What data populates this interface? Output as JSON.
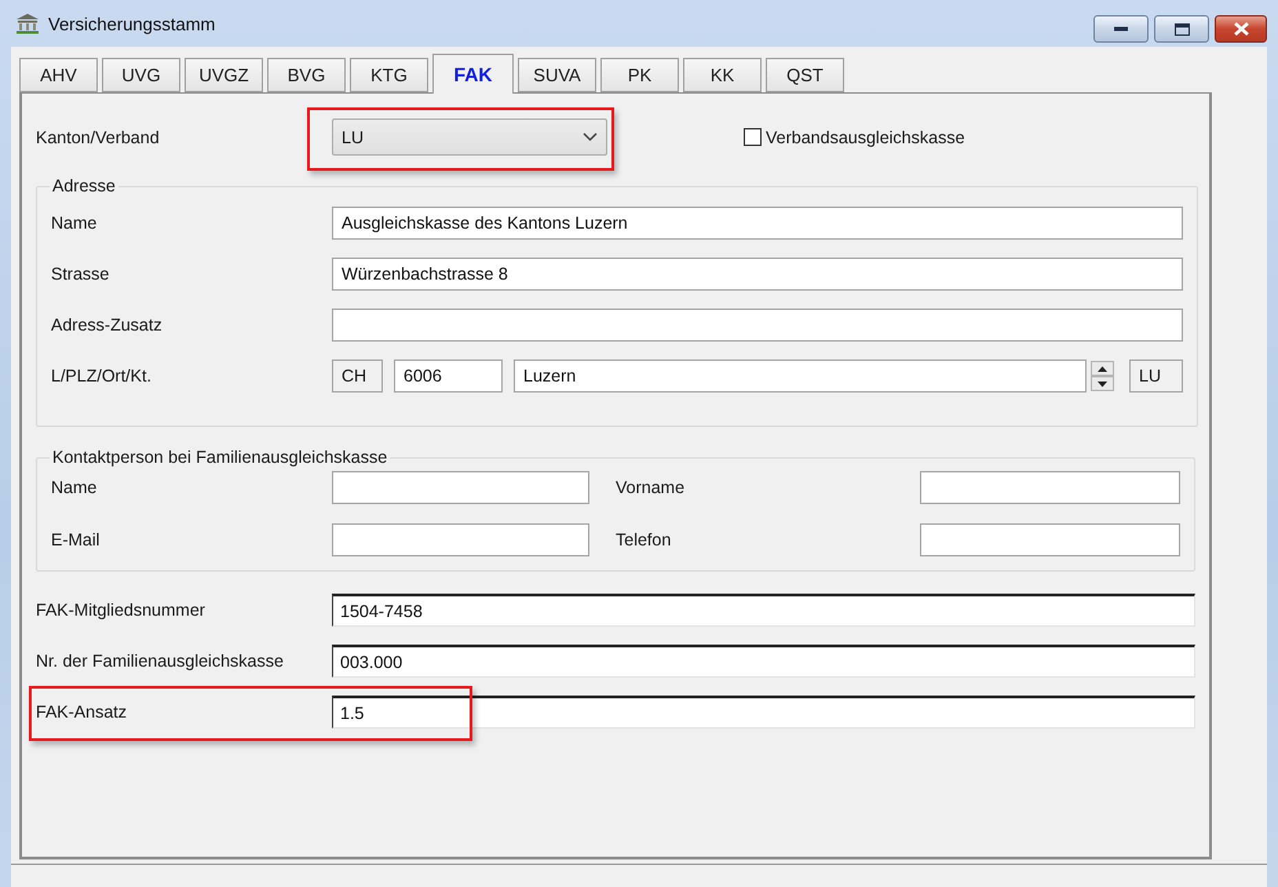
{
  "window": {
    "title": "Versicherungsstamm"
  },
  "tabs": [
    {
      "label": "AHV",
      "selected": false
    },
    {
      "label": "UVG",
      "selected": false
    },
    {
      "label": "UVGZ",
      "selected": false
    },
    {
      "label": "BVG",
      "selected": false
    },
    {
      "label": "KTG",
      "selected": false
    },
    {
      "label": "FAK",
      "selected": true
    },
    {
      "label": "SUVA",
      "selected": false
    },
    {
      "label": "PK",
      "selected": false
    },
    {
      "label": "KK",
      "selected": false
    },
    {
      "label": "QST",
      "selected": false
    }
  ],
  "kanton": {
    "label": "Kanton/Verband",
    "value": "LU",
    "highlighted": true
  },
  "verband_checkbox": {
    "label": "Verbandsausgleichskasse",
    "checked": false
  },
  "address": {
    "title": "Adresse",
    "fields": [
      {
        "label": "Name",
        "value": "Ausgleichskasse des Kantons Luzern"
      },
      {
        "label": "Strasse",
        "value": "Würzenbachstrasse 8"
      },
      {
        "label": "Adress-Zusatz"
      }
    ],
    "location": {
      "label": "L/PLZ/Ort/Kt.",
      "country": "CH",
      "zip": "6006",
      "city": "Luzern",
      "canton": "LU"
    }
  },
  "contact": {
    "title": "Kontaktperson bei Familienausgleichskasse",
    "fields": [
      {
        "label": "Name"
      },
      {
        "label": "Vorname"
      },
      {
        "label": "E-Mail"
      },
      {
        "label": "Telefon"
      }
    ]
  },
  "fak_fields": [
    {
      "label": "FAK-Mitgliedsnummer",
      "value": "1504-7458",
      "highlighted": false
    },
    {
      "label": "Nr. der Familienausgleichskasse",
      "value": "003.000",
      "highlighted": false
    },
    {
      "label": "FAK-Ansatz",
      "value": "1.5",
      "highlighted": true
    }
  ]
}
